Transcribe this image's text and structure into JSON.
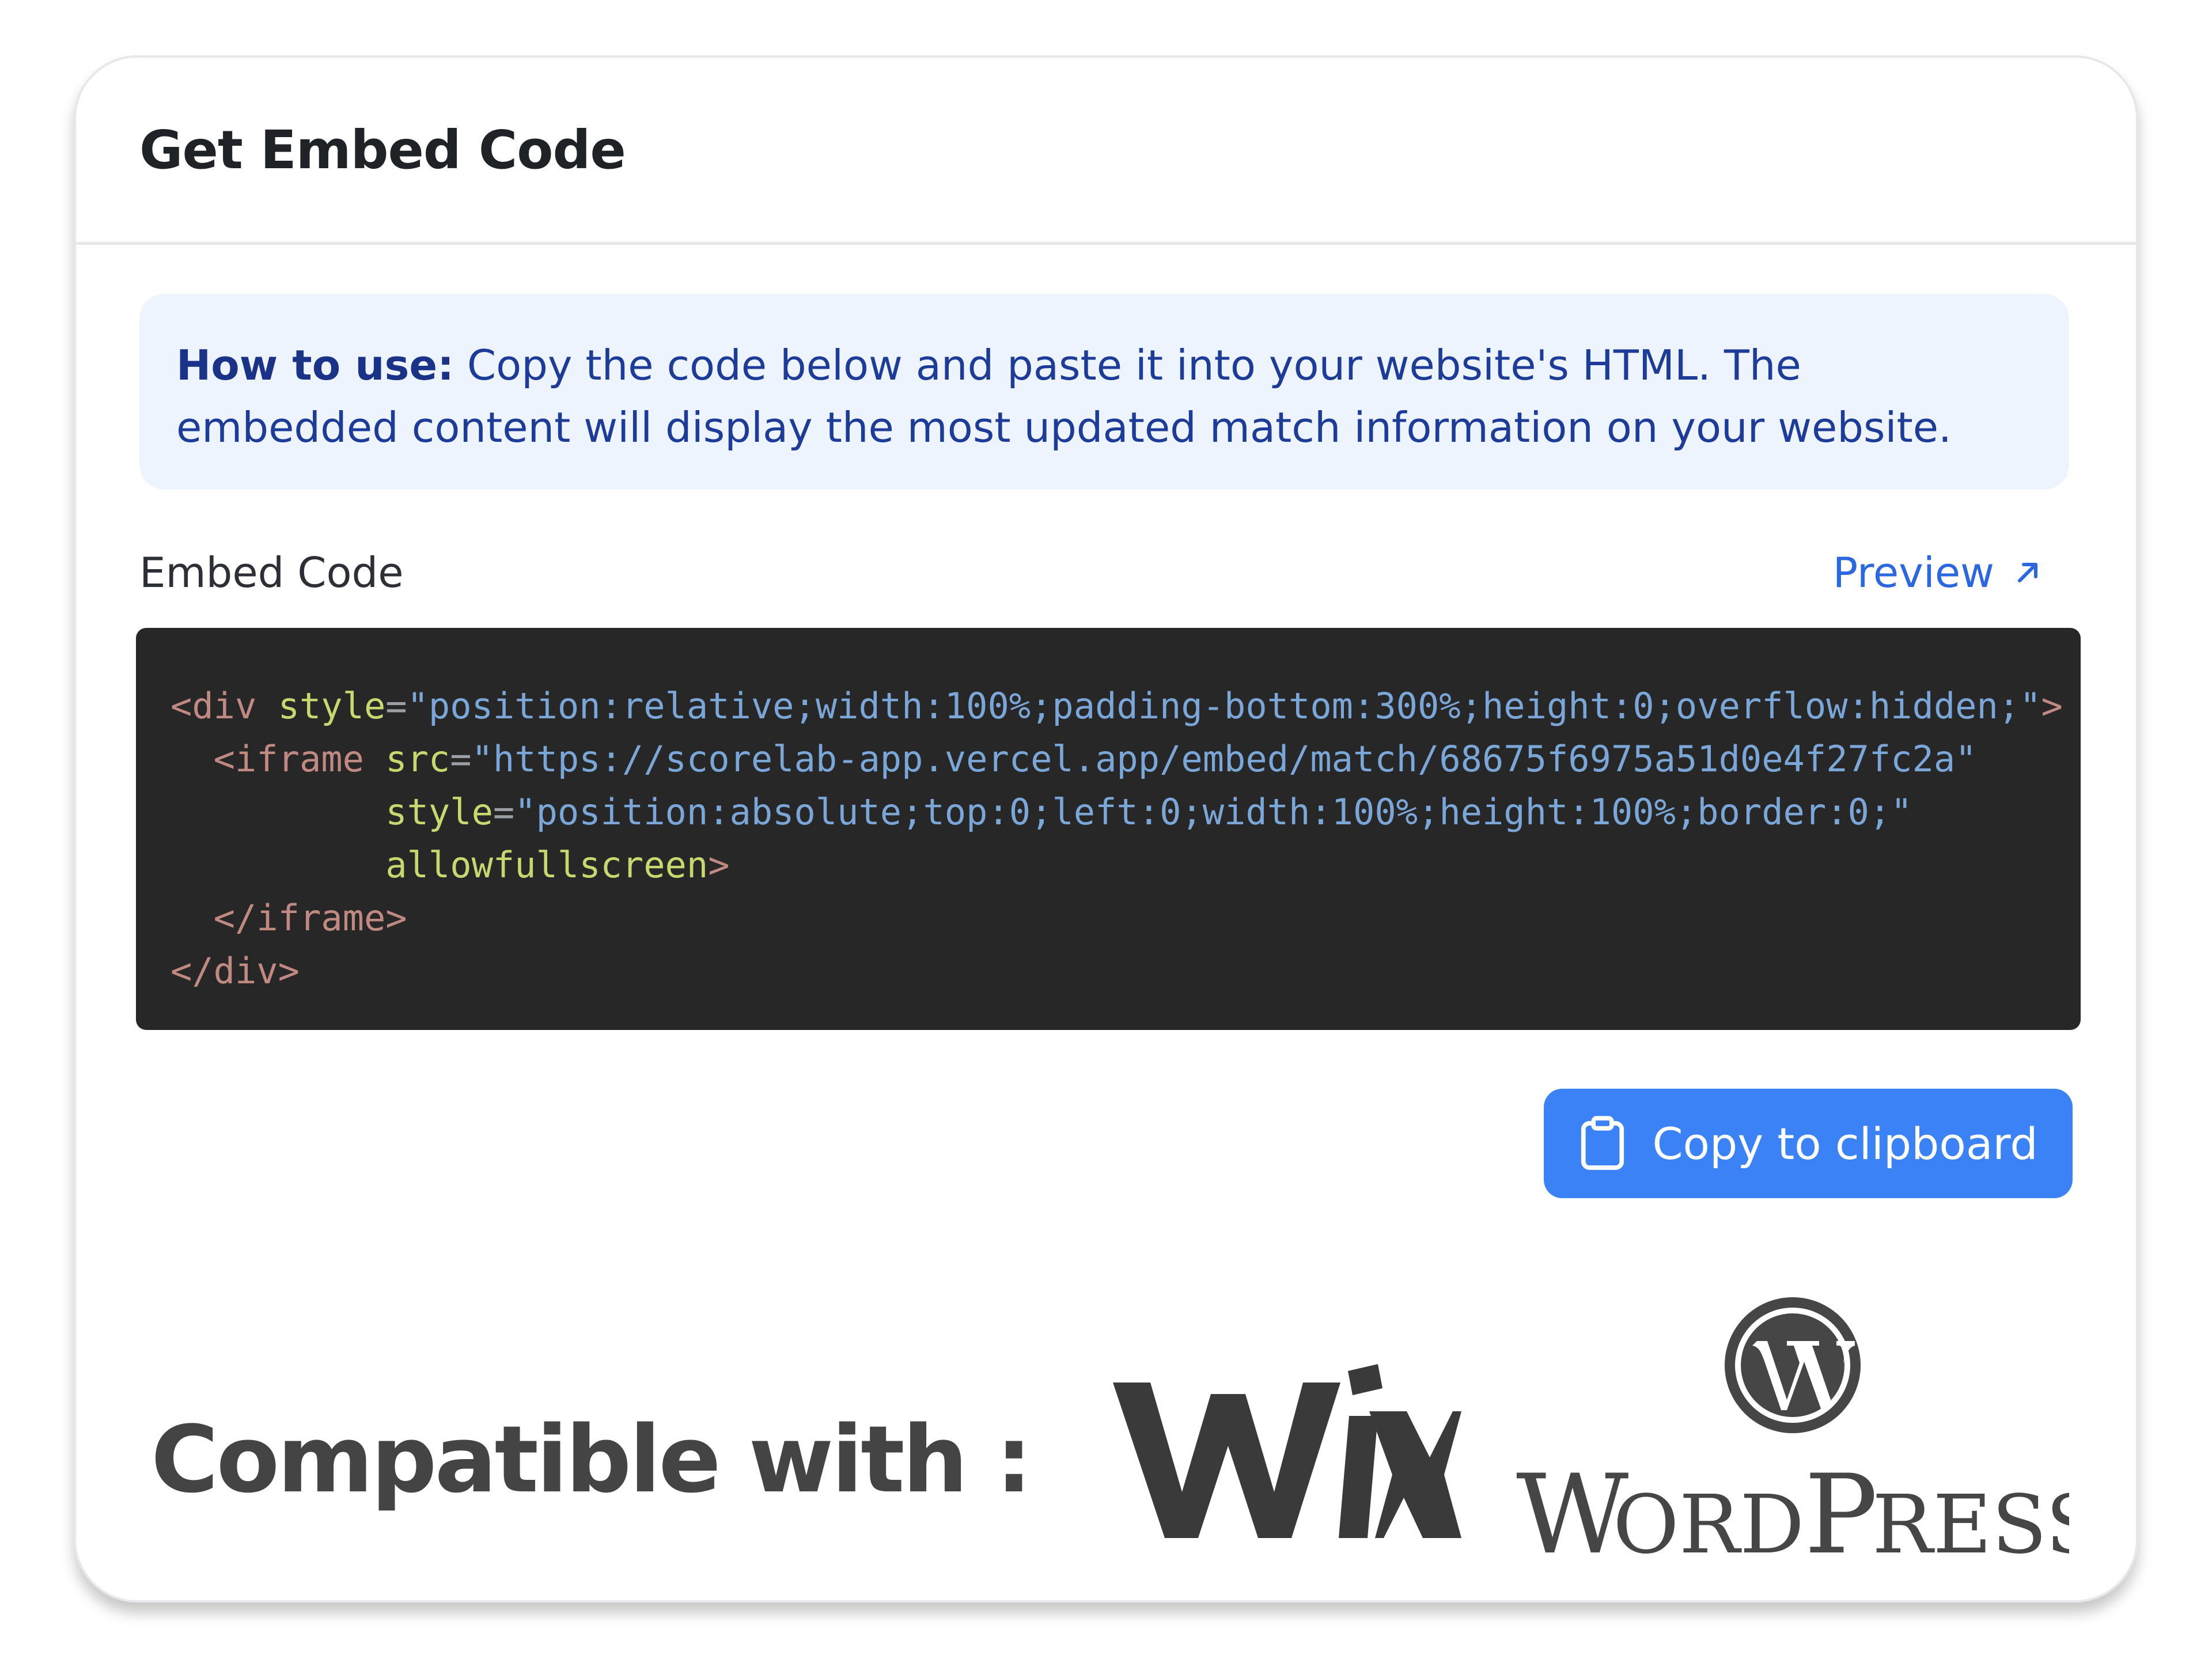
{
  "header": {
    "title": "Get Embed Code"
  },
  "info": {
    "strong": "How to use:",
    "text": " Copy the code below and paste it into your website's HTML. The embedded content will display the most updated match information on your website."
  },
  "embed": {
    "label": "Embed Code",
    "preview_label": "Preview",
    "code_lines": [
      [
        {
          "t": "tag",
          "v": "<div "
        },
        {
          "t": "attr",
          "v": "style"
        },
        {
          "t": "eq",
          "v": "="
        },
        {
          "t": "val",
          "v": "\"position:relative;width:100%;padding-bottom:300%;height:0;overflow:hidden;\""
        },
        {
          "t": "tag",
          "v": ">"
        }
      ],
      [
        {
          "t": "tag",
          "v": "  <iframe "
        },
        {
          "t": "attr",
          "v": "src"
        },
        {
          "t": "eq",
          "v": "="
        },
        {
          "t": "val",
          "v": "\"https://scorelab-app.vercel.app/embed/match/68675f6975a51d0e4f27fc2a\""
        }
      ],
      [
        {
          "t": "tag",
          "v": "          "
        },
        {
          "t": "attr",
          "v": "style"
        },
        {
          "t": "eq",
          "v": "="
        },
        {
          "t": "val",
          "v": "\"position:absolute;top:0;left:0;width:100%;height:100%;border:0;\""
        }
      ],
      [
        {
          "t": "tag",
          "v": "          "
        },
        {
          "t": "attr",
          "v": "allowfullscreen"
        },
        {
          "t": "tag",
          "v": ">"
        }
      ],
      [
        {
          "t": "tag",
          "v": "  </iframe>"
        }
      ],
      [
        {
          "t": "tag",
          "v": "</div>"
        }
      ]
    ],
    "copy_label": "Copy to clipboard"
  },
  "compat": {
    "label": "Compatible with :",
    "logos": [
      {
        "name": "wix-logo",
        "text": "WiX"
      },
      {
        "name": "wordpress-logo",
        "text": "WordPress"
      }
    ]
  },
  "colors": {
    "accent": "#3b82f6",
    "link": "#2b67e0",
    "info_bg": "#eef4fd",
    "code_bg": "#272727"
  }
}
